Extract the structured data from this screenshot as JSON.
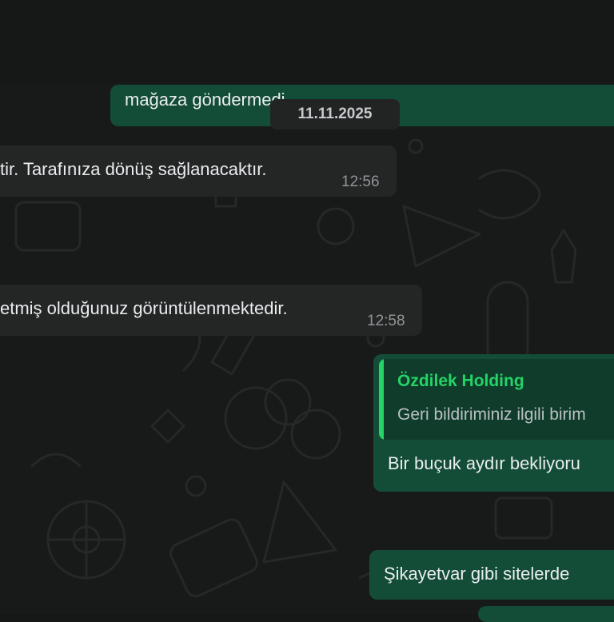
{
  "date_chip": "11.11.2025",
  "messages": [
    {
      "text": "mağaza göndermedi"
    },
    {
      "text": "tir. Tarafınıza dönüş sağlanacaktır.",
      "time": "12:56"
    },
    {
      "text": "etmiş olduğunuz görüntülenmektedir.",
      "time": "12:58"
    },
    {
      "quote_author": "Özdilek Holding",
      "quote_text": "Geri bildiriminiz ilgili birim",
      "text": "Bir buçuk aydır bekliyoru"
    },
    {
      "text": "Şikayetvar gibi sitelerde"
    }
  ],
  "colors": {
    "incoming": "#242626",
    "outgoing": "#144d37",
    "accent": "#25d366",
    "background": "#181919"
  }
}
